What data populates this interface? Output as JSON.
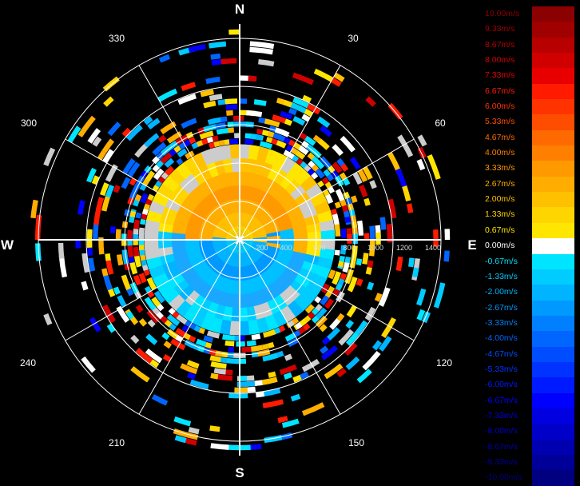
{
  "compass": {
    "north": "N",
    "south": "S",
    "east": "E",
    "west": "W"
  },
  "azimuth_labels": [
    "30",
    "60",
    "120",
    "150",
    "210",
    "240",
    "300",
    "330"
  ],
  "range_labels": [
    "200",
    "400",
    "600",
    "800",
    "1000",
    "1200",
    "1400"
  ],
  "legend": [
    {
      "label": "10.00m/s",
      "color": "#8b0000"
    },
    {
      "label": "9.33m/s",
      "color": "#a00000"
    },
    {
      "label": "8.67m/s",
      "color": "#b80000"
    },
    {
      "label": "8.00m/s",
      "color": "#d00000"
    },
    {
      "label": "7.33m/s",
      "color": "#e80000"
    },
    {
      "label": "6.67m/s",
      "color": "#ff1a00"
    },
    {
      "label": "6.00m/s",
      "color": "#ff3300"
    },
    {
      "label": "5.33m/s",
      "color": "#ff4d00"
    },
    {
      "label": "4.67m/s",
      "color": "#ff6a00"
    },
    {
      "label": "4.00m/s",
      "color": "#ff8000"
    },
    {
      "label": "3.33m/s",
      "color": "#ff9900"
    },
    {
      "label": "2.67m/s",
      "color": "#ffad00"
    },
    {
      "label": "2.00m/s",
      "color": "#ffc000"
    },
    {
      "label": "1.33m/s",
      "color": "#ffd500"
    },
    {
      "label": "0.67m/s",
      "color": "#ffe600"
    },
    {
      "label": "0.00m/s",
      "color": "#ffffff"
    },
    {
      "label": "-0.67m/s",
      "color": "#00e5ff"
    },
    {
      "label": "-1.33m/s",
      "color": "#00ccff"
    },
    {
      "label": "-2.00m/s",
      "color": "#00b4ff"
    },
    {
      "label": "-2.67m/s",
      "color": "#0099ff"
    },
    {
      "label": "-3.33m/s",
      "color": "#0080ff"
    },
    {
      "label": "-4.00m/s",
      "color": "#0066ff"
    },
    {
      "label": "-4.67m/s",
      "color": "#004dff"
    },
    {
      "label": "-5.33m/s",
      "color": "#0033ff"
    },
    {
      "label": "-6.00m/s",
      "color": "#001aff"
    },
    {
      "label": "-6.67m/s",
      "color": "#0000ff"
    },
    {
      "label": "-7.33m/s",
      "color": "#0000e0"
    },
    {
      "label": "-8.00m/s",
      "color": "#0000c8"
    },
    {
      "label": "-8.67m/s",
      "color": "#0000b0"
    },
    {
      "label": "-9.33m/s",
      "color": "#000098"
    },
    {
      "label": "-10.00m/s",
      "color": "#000080"
    }
  ]
}
